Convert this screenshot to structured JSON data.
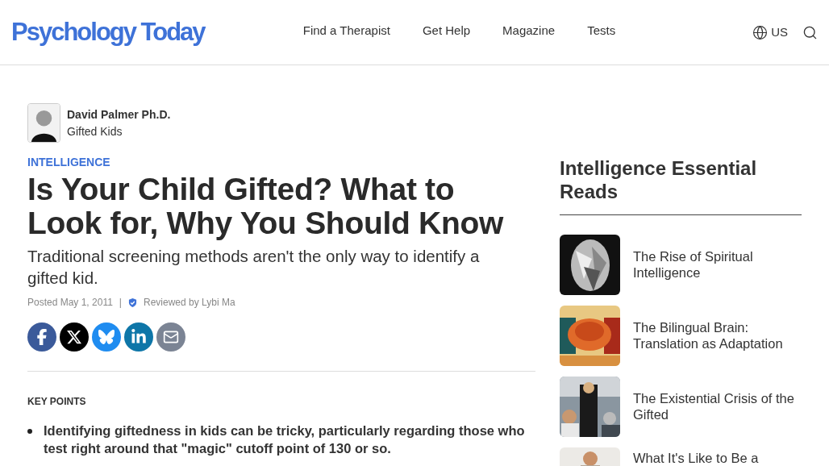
{
  "logo": "Psychology Today",
  "nav": [
    "Find a Therapist",
    "Get Help",
    "Magazine",
    "Tests"
  ],
  "region": "US",
  "author": {
    "name": "David Palmer Ph.D.",
    "blog": "Gifted Kids"
  },
  "category": "INTELLIGENCE",
  "title": "Is Your Child Gifted? What to Look for, Why You Should Know",
  "subtitle": "Traditional screening methods aren't the only way to identify a gifted kid.",
  "posted": "Posted May 1, 2011",
  "separator": "|",
  "reviewed": "Reviewed by Lybi Ma",
  "share": [
    {
      "kind": "facebook"
    },
    {
      "kind": "x"
    },
    {
      "kind": "bluesky"
    },
    {
      "kind": "linkedin"
    },
    {
      "kind": "email"
    }
  ],
  "key_points": {
    "heading": "KEY POINTS",
    "items": [
      "Identifying giftedness in kids can be tricky, particularly regarding those who test right around that \"magic\" cutoff point of 130 or so."
    ]
  },
  "essential_reads": {
    "heading": "Intelligence Essential Reads",
    "items": [
      {
        "title": "The Rise of Spiritual Intelligence"
      },
      {
        "title": "The Bilingual Brain: Translation as Adaptation"
      },
      {
        "title": "The Existential Crisis of the Gifted"
      },
      {
        "title": "What It's Like to Be a"
      }
    ]
  }
}
